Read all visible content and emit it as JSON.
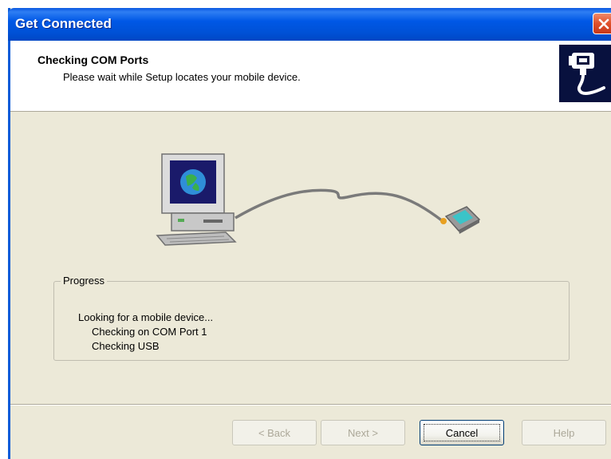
{
  "window": {
    "title": "Get Connected"
  },
  "header": {
    "title": "Checking COM Ports",
    "subtitle": "Please wait while Setup locates your mobile device."
  },
  "progress": {
    "label": "Progress",
    "lines": [
      "Looking for a mobile device...",
      "Checking on COM Port 1",
      "Checking USB"
    ]
  },
  "buttons": {
    "back": "< Back",
    "next": "Next >",
    "cancel": "Cancel",
    "help": "Help"
  },
  "colors": {
    "titlebar": "#0058e6",
    "dialog_bg": "#ece9d8",
    "close": "#e0502a",
    "logo_bg": "#08113e"
  },
  "icons": {
    "close": "close-icon",
    "logo": "cable-connector-icon",
    "computer": "desktop-computer-icon",
    "device": "handheld-device-icon"
  }
}
